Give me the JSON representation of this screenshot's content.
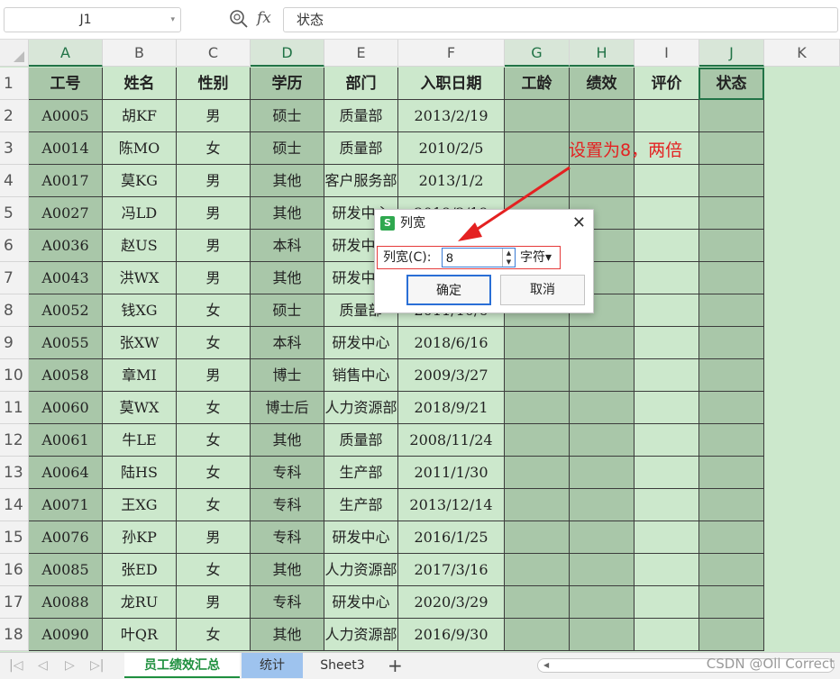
{
  "formula_bar": {
    "name_box": "J1",
    "fx": "fx",
    "formula": "状态"
  },
  "columns": [
    "A",
    "B",
    "C",
    "D",
    "E",
    "F",
    "G",
    "H",
    "I",
    "J",
    "K"
  ],
  "rows": [
    "1",
    "2",
    "3",
    "4",
    "5",
    "6",
    "7",
    "8",
    "9",
    "10",
    "11",
    "12",
    "13",
    "14",
    "15",
    "16",
    "17",
    "18"
  ],
  "headers": [
    "工号",
    "姓名",
    "性别",
    "学历",
    "部门",
    "入职日期",
    "工龄",
    "绩效",
    "评价",
    "状态"
  ],
  "records": [
    [
      "A0005",
      "胡KF",
      "男",
      "硕士",
      "质量部",
      "2013/2/19"
    ],
    [
      "A0014",
      "陈MO",
      "女",
      "硕士",
      "质量部",
      "2010/2/5"
    ],
    [
      "A0017",
      "莫KG",
      "男",
      "其他",
      "客户服务部",
      "2013/1/2"
    ],
    [
      "A0027",
      "冯LD",
      "男",
      "其他",
      "研发中心",
      "2019/2/19"
    ],
    [
      "A0036",
      "赵US",
      "男",
      "本科",
      "研发中心",
      ""
    ],
    [
      "A0043",
      "洪WX",
      "男",
      "其他",
      "研发中心",
      ""
    ],
    [
      "A0052",
      "钱XG",
      "女",
      "硕士",
      "质量部",
      "2011/10/6"
    ],
    [
      "A0055",
      "张XW",
      "女",
      "本科",
      "研发中心",
      "2018/6/16"
    ],
    [
      "A0058",
      "章MI",
      "男",
      "博士",
      "销售中心",
      "2009/3/27"
    ],
    [
      "A0060",
      "莫WX",
      "女",
      "博士后",
      "人力资源部",
      "2018/9/21"
    ],
    [
      "A0061",
      "牛LE",
      "女",
      "其他",
      "质量部",
      "2008/11/24"
    ],
    [
      "A0064",
      "陆HS",
      "女",
      "专科",
      "生产部",
      "2011/1/30"
    ],
    [
      "A0071",
      "王XG",
      "女",
      "专科",
      "生产部",
      "2013/12/14"
    ],
    [
      "A0076",
      "孙KP",
      "男",
      "专科",
      "研发中心",
      "2016/1/25"
    ],
    [
      "A0085",
      "张ED",
      "女",
      "其他",
      "人力资源部",
      "2017/3/16"
    ],
    [
      "A0088",
      "龙RU",
      "男",
      "专科",
      "研发中心",
      "2020/3/29"
    ],
    [
      "A0090",
      "叶QR",
      "女",
      "其他",
      "人力资源部",
      "2016/9/30"
    ]
  ],
  "dialog": {
    "title": "列宽",
    "label": "列宽(C):",
    "value": "8",
    "unit": "字符",
    "ok": "确定",
    "cancel": "取消",
    "close": "✕"
  },
  "annotation": "设置为8，两倍",
  "sheet_tabs": [
    "员工绩效汇总",
    "统计",
    "Sheet3"
  ],
  "watermark": "CSDN @Oll Correct",
  "colors": {
    "selected_header": "#217346",
    "annotation": "#e42121",
    "sheet_bg": "#cce8cc",
    "dark_col": "#a9c7a9"
  }
}
